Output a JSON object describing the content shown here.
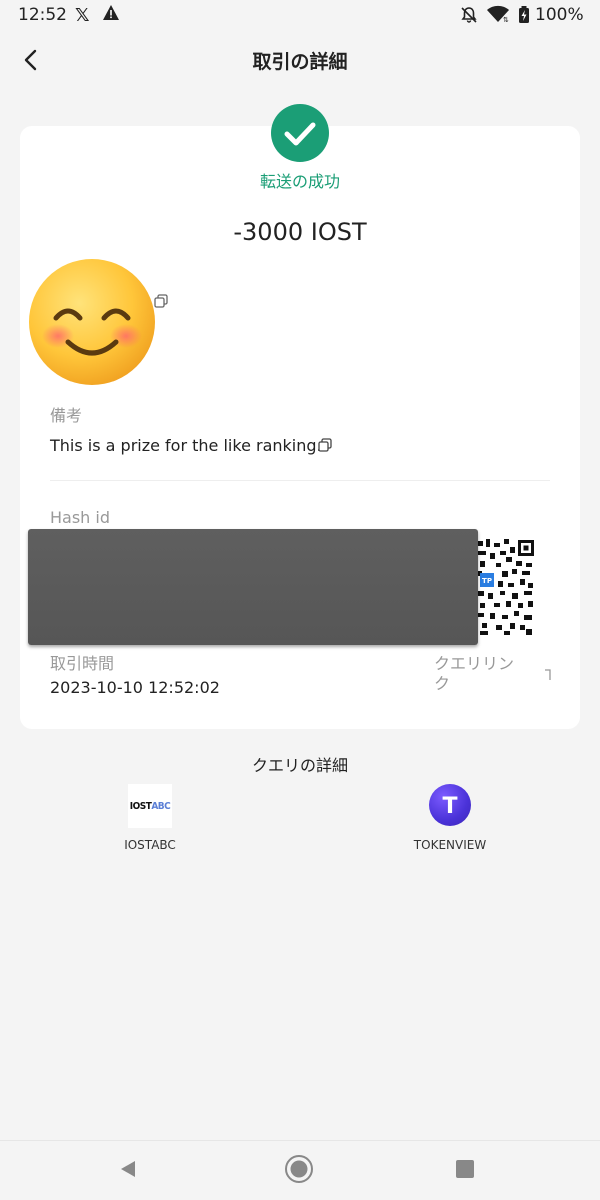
{
  "status_bar": {
    "time": "12:52",
    "battery": "100%"
  },
  "header": {
    "title": "取引の詳細"
  },
  "transaction": {
    "status": "転送の成功",
    "amount": "-3000 IOST",
    "memo_label": "備考",
    "memo_value": "This is a prize for the like ranking.",
    "hash_label": "Hash id",
    "time_label": "取引時間",
    "time_value": "2023-10-10 12:52:02",
    "query_link_line1": "クエリリン",
    "query_link_line2": "ク",
    "qr_badge": "TP"
  },
  "explorers": {
    "title": "クエリの詳細",
    "items": [
      {
        "logo_main": "IOST",
        "logo_accent": "ABC",
        "name": "IOSTABC"
      },
      {
        "logo_letter": "T",
        "name": "TOKENVIEW"
      }
    ]
  },
  "colors": {
    "success": "#1b9e76",
    "background": "#f4f4f4",
    "card": "#ffffff",
    "muted": "#999999"
  },
  "icons": {
    "status": [
      "x-logo-icon",
      "warning-icon",
      "bell-off-icon",
      "wifi-icon",
      "battery-icon"
    ],
    "header": "chevron-left-icon",
    "success": "check-circle-icon",
    "copy": "copy-icon",
    "nav": [
      "nav-back-icon",
      "nav-home-icon",
      "nav-recent-icon"
    ]
  }
}
